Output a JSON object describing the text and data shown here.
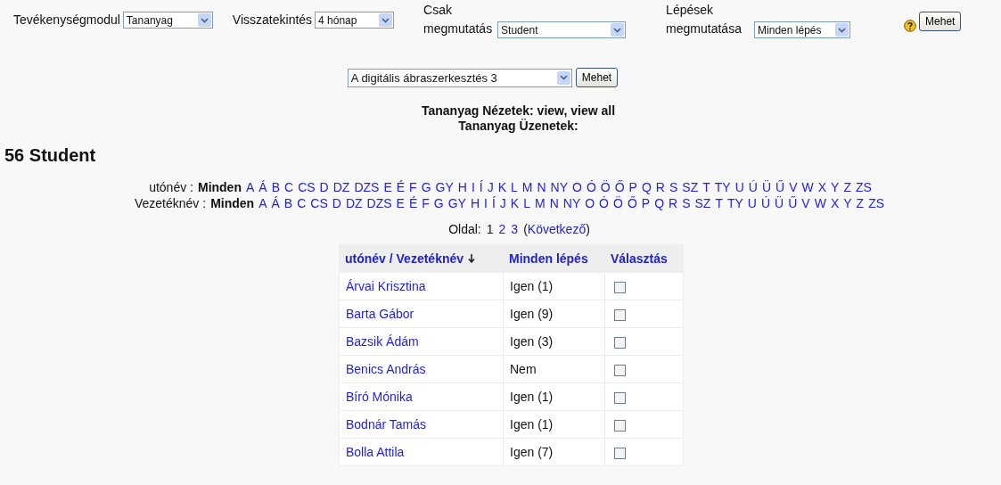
{
  "filters": [
    {
      "label": "Tevékenységmodul",
      "value": "Tananyag",
      "kind": "inline"
    },
    {
      "label": "Visszatekintés",
      "value": "4 hónap",
      "kind": "inline"
    },
    {
      "label": "Csak megmutatás",
      "value": "Student",
      "kind": "wrap"
    },
    {
      "label": "Lépések megmutatása",
      "value": "Minden lépés",
      "kind": "wrap"
    }
  ],
  "go_button": "Mehet",
  "course_select": {
    "value": "A digitális ábraszerkesztés 3",
    "button": "Mehet"
  },
  "summary": [
    "Tananyag Nézetek: view, view all",
    "Tananyag Üzenetek:"
  ],
  "heading": "56 Student",
  "initials_bars": [
    {
      "label": "utónév :",
      "letters": [
        {
          "text": "Minden",
          "selected": true
        },
        {
          "text": "A",
          "selected": false
        },
        {
          "text": "Á",
          "selected": false
        },
        {
          "text": "B",
          "selected": false
        },
        {
          "text": "C",
          "selected": false
        },
        {
          "text": "CS",
          "selected": false
        },
        {
          "text": "D",
          "selected": false
        },
        {
          "text": "DZ",
          "selected": false
        },
        {
          "text": "DZS",
          "selected": false
        },
        {
          "text": "E",
          "selected": false
        },
        {
          "text": "É",
          "selected": false
        },
        {
          "text": "F",
          "selected": false
        },
        {
          "text": "G",
          "selected": false
        },
        {
          "text": "GY",
          "selected": false
        },
        {
          "text": "H",
          "selected": false
        },
        {
          "text": "I",
          "selected": false
        },
        {
          "text": "Í",
          "selected": false
        },
        {
          "text": "J",
          "selected": false
        },
        {
          "text": "K",
          "selected": false
        },
        {
          "text": "L",
          "selected": false
        },
        {
          "text": "M",
          "selected": false
        },
        {
          "text": "N",
          "selected": false
        },
        {
          "text": "NY",
          "selected": false
        },
        {
          "text": "O",
          "selected": false
        },
        {
          "text": "Ó",
          "selected": false
        },
        {
          "text": "Ö",
          "selected": false
        },
        {
          "text": "Ő",
          "selected": false
        },
        {
          "text": "P",
          "selected": false
        },
        {
          "text": "Q",
          "selected": false
        },
        {
          "text": "R",
          "selected": false
        },
        {
          "text": "S",
          "selected": false
        },
        {
          "text": "SZ",
          "selected": false
        },
        {
          "text": "T",
          "selected": false
        },
        {
          "text": "TY",
          "selected": false
        },
        {
          "text": "U",
          "selected": false
        },
        {
          "text": "Ú",
          "selected": false
        },
        {
          "text": "Ü",
          "selected": false
        },
        {
          "text": "Ű",
          "selected": false
        },
        {
          "text": "V",
          "selected": false
        },
        {
          "text": "W",
          "selected": false
        },
        {
          "text": "X",
          "selected": false
        },
        {
          "text": "Y",
          "selected": false
        },
        {
          "text": "Z",
          "selected": false
        },
        {
          "text": "ZS",
          "selected": false
        }
      ]
    },
    {
      "label": "Vezetéknév :",
      "letters": [
        {
          "text": "Minden",
          "selected": true
        },
        {
          "text": "A",
          "selected": false
        },
        {
          "text": "Á",
          "selected": false
        },
        {
          "text": "B",
          "selected": false
        },
        {
          "text": "C",
          "selected": false
        },
        {
          "text": "CS",
          "selected": false
        },
        {
          "text": "D",
          "selected": false
        },
        {
          "text": "DZ",
          "selected": false
        },
        {
          "text": "DZS",
          "selected": false
        },
        {
          "text": "E",
          "selected": false
        },
        {
          "text": "É",
          "selected": false
        },
        {
          "text": "F",
          "selected": false
        },
        {
          "text": "G",
          "selected": false
        },
        {
          "text": "GY",
          "selected": false
        },
        {
          "text": "H",
          "selected": false
        },
        {
          "text": "I",
          "selected": false
        },
        {
          "text": "Í",
          "selected": false
        },
        {
          "text": "J",
          "selected": false
        },
        {
          "text": "K",
          "selected": false
        },
        {
          "text": "L",
          "selected": false
        },
        {
          "text": "M",
          "selected": false
        },
        {
          "text": "N",
          "selected": false
        },
        {
          "text": "NY",
          "selected": false
        },
        {
          "text": "O",
          "selected": false
        },
        {
          "text": "Ó",
          "selected": false
        },
        {
          "text": "Ö",
          "selected": false
        },
        {
          "text": "Ő",
          "selected": false
        },
        {
          "text": "P",
          "selected": false
        },
        {
          "text": "Q",
          "selected": false
        },
        {
          "text": "R",
          "selected": false
        },
        {
          "text": "S",
          "selected": false
        },
        {
          "text": "SZ",
          "selected": false
        },
        {
          "text": "T",
          "selected": false
        },
        {
          "text": "TY",
          "selected": false
        },
        {
          "text": "U",
          "selected": false
        },
        {
          "text": "Ú",
          "selected": false
        },
        {
          "text": "Ü",
          "selected": false
        },
        {
          "text": "Ű",
          "selected": false
        },
        {
          "text": "V",
          "selected": false
        },
        {
          "text": "W",
          "selected": false
        },
        {
          "text": "X",
          "selected": false
        },
        {
          "text": "Y",
          "selected": false
        },
        {
          "text": "Z",
          "selected": false
        },
        {
          "text": "ZS",
          "selected": false
        }
      ]
    }
  ],
  "pager": {
    "label": "Oldal:",
    "pages": [
      {
        "text": "1",
        "selected": true
      },
      {
        "text": "2",
        "selected": false
      },
      {
        "text": "3",
        "selected": false
      }
    ],
    "next": {
      "open": "(",
      "label": "Következő",
      "close": ")"
    }
  },
  "table": {
    "columns": [
      {
        "label": "utónév / Vezetéknév",
        "sorted": true
      },
      {
        "label": "Minden lépés",
        "sorted": false
      },
      {
        "label": "Választás",
        "sorted": false
      }
    ],
    "rows": [
      {
        "name": "Árvai Krisztina",
        "steps": "Igen (1)",
        "checked": false
      },
      {
        "name": "Barta Gábor",
        "steps": "Igen (9)",
        "checked": false
      },
      {
        "name": "Bazsik Ádám",
        "steps": "Igen (3)",
        "checked": false
      },
      {
        "name": "Benics András",
        "steps": "Nem",
        "checked": false
      },
      {
        "name": "Bíró Mónika",
        "steps": "Igen (1)",
        "checked": false
      },
      {
        "name": "Bodnár Tamás",
        "steps": "Igen (1)",
        "checked": false
      },
      {
        "name": "Bolla Attila",
        "steps": "Igen (7)",
        "checked": false
      }
    ]
  }
}
